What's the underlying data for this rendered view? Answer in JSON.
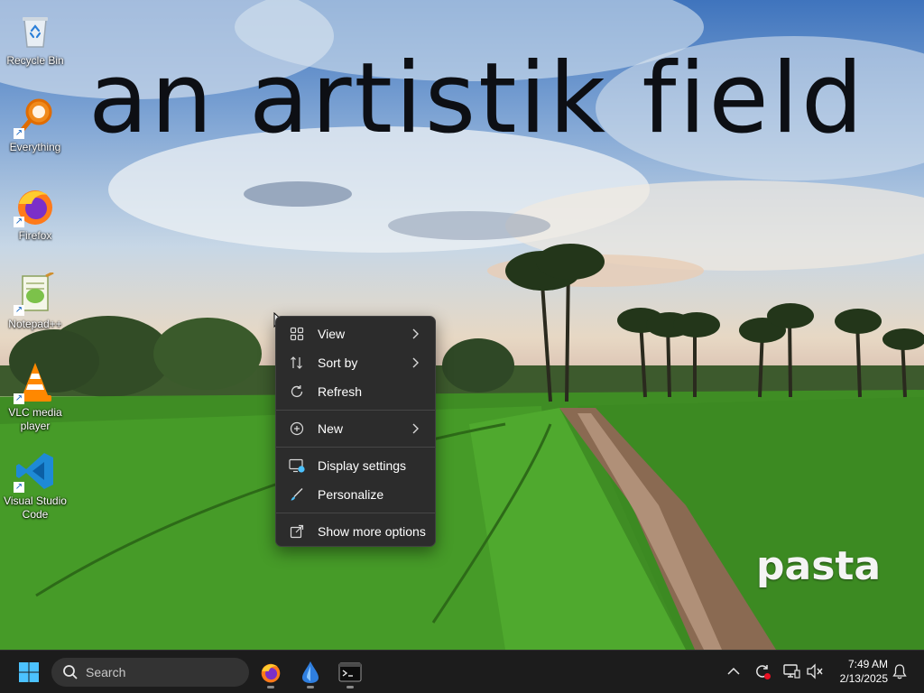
{
  "wallpaper": {
    "title_text": "an artistik field",
    "signature_text": "pasta"
  },
  "desktop_icons": [
    {
      "label": "Recycle Bin",
      "icon": "recycle-bin-icon"
    },
    {
      "label": "Everything",
      "icon": "everything-search-icon"
    },
    {
      "label": "Firefox",
      "icon": "firefox-icon"
    },
    {
      "label": "Notepad++",
      "icon": "notepad-plus-plus-icon"
    },
    {
      "label": "VLC media player",
      "icon": "vlc-icon"
    },
    {
      "label": "Visual Studio Code",
      "icon": "vscode-icon"
    }
  ],
  "context_menu": {
    "items": [
      {
        "label": "View",
        "icon": "grid-view-icon",
        "submenu": true
      },
      {
        "label": "Sort by",
        "icon": "sort-icon",
        "submenu": true
      },
      {
        "label": "Refresh",
        "icon": "refresh-icon",
        "submenu": false
      },
      {
        "label": "New",
        "icon": "new-plus-icon",
        "submenu": true
      },
      {
        "label": "Display settings",
        "icon": "display-settings-icon",
        "submenu": false
      },
      {
        "label": "Personalize",
        "icon": "personalize-brush-icon",
        "submenu": false
      },
      {
        "label": "Show more options",
        "icon": "show-more-options-icon",
        "submenu": false
      }
    ]
  },
  "taskbar": {
    "search_placeholder": "Search",
    "pinned_apps": [
      {
        "name": "Firefox",
        "icon": "firefox-icon",
        "running": true
      },
      {
        "name": "App",
        "icon": "blue-drop-app-icon",
        "running": true
      },
      {
        "name": "Terminal",
        "icon": "terminal-icon",
        "running": true
      }
    ],
    "tray_icons": [
      "chevron-up-icon",
      "sync-status-icon",
      "network-icon",
      "volume-muted-icon",
      "notification-bell-icon"
    ],
    "clock": {
      "time": "7:49 AM",
      "date": "2/13/2025"
    }
  },
  "colors": {
    "menu_bg": "#2c2c2c",
    "taskbar_bg": "#1c1c1c",
    "start_accent": "#4cc2ff"
  }
}
